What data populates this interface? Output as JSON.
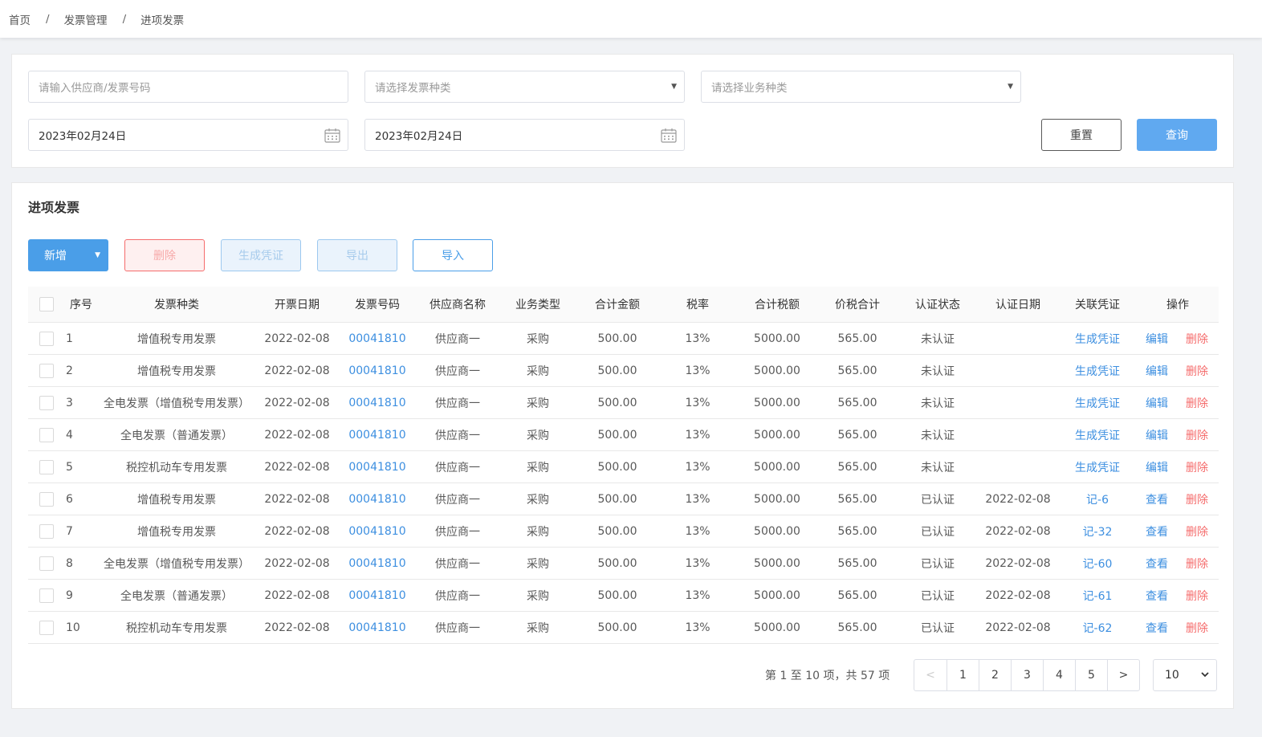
{
  "breadcrumb": {
    "items": [
      "首页",
      "发票管理",
      "进项发票"
    ],
    "separator": "/"
  },
  "filters": {
    "search_placeholder": "请输入供应商/发票号码",
    "invoice_type_placeholder": "请选择发票种类",
    "business_type_placeholder": "请选择业务种类",
    "date_start": "2023年02月24日",
    "date_end": "2023年02月24日",
    "reset_label": "重置",
    "query_label": "查询"
  },
  "section_title": "进项发票",
  "toolbar": {
    "add_label": "新增",
    "delete_label": "删除",
    "voucher_label": "生成凭证",
    "export_label": "导出",
    "import_label": "导入"
  },
  "table": {
    "columns": [
      "序号",
      "发票种类",
      "开票日期",
      "发票号码",
      "供应商名称",
      "业务类型",
      "合计金额",
      "税率",
      "合计税额",
      "价税合计",
      "认证状态",
      "认证日期",
      "关联凭证",
      "操作"
    ],
    "rows": [
      {
        "no": "1",
        "type": "增值税专用发票",
        "date": "2022-02-08",
        "number": "00041810",
        "supplier": "供应商一",
        "biz": "采购",
        "amount": "500.00",
        "rate": "13%",
        "tax": "5000.00",
        "total": "565.00",
        "status": "未认证",
        "cert_date": "",
        "voucher": "生成凭证",
        "action": "编辑",
        "del": "删除"
      },
      {
        "no": "2",
        "type": "增值税专用发票",
        "date": "2022-02-08",
        "number": "00041810",
        "supplier": "供应商一",
        "biz": "采购",
        "amount": "500.00",
        "rate": "13%",
        "tax": "5000.00",
        "total": "565.00",
        "status": "未认证",
        "cert_date": "",
        "voucher": "生成凭证",
        "action": "编辑",
        "del": "删除"
      },
      {
        "no": "3",
        "type": "全电发票（增值税专用发票）",
        "date": "2022-02-08",
        "number": "00041810",
        "supplier": "供应商一",
        "biz": "采购",
        "amount": "500.00",
        "rate": "13%",
        "tax": "5000.00",
        "total": "565.00",
        "status": "未认证",
        "cert_date": "",
        "voucher": "生成凭证",
        "action": "编辑",
        "del": "删除"
      },
      {
        "no": "4",
        "type": "全电发票（普通发票）",
        "date": "2022-02-08",
        "number": "00041810",
        "supplier": "供应商一",
        "biz": "采购",
        "amount": "500.00",
        "rate": "13%",
        "tax": "5000.00",
        "total": "565.00",
        "status": "未认证",
        "cert_date": "",
        "voucher": "生成凭证",
        "action": "编辑",
        "del": "删除"
      },
      {
        "no": "5",
        "type": "税控机动车专用发票",
        "date": "2022-02-08",
        "number": "00041810",
        "supplier": "供应商一",
        "biz": "采购",
        "amount": "500.00",
        "rate": "13%",
        "tax": "5000.00",
        "total": "565.00",
        "status": "未认证",
        "cert_date": "",
        "voucher": "生成凭证",
        "action": "编辑",
        "del": "删除"
      },
      {
        "no": "6",
        "type": "增值税专用发票",
        "date": "2022-02-08",
        "number": "00041810",
        "supplier": "供应商一",
        "biz": "采购",
        "amount": "500.00",
        "rate": "13%",
        "tax": "5000.00",
        "total": "565.00",
        "status": "已认证",
        "cert_date": "2022-02-08",
        "voucher": "记-6",
        "action": "查看",
        "del": "删除"
      },
      {
        "no": "7",
        "type": "增值税专用发票",
        "date": "2022-02-08",
        "number": "00041810",
        "supplier": "供应商一",
        "biz": "采购",
        "amount": "500.00",
        "rate": "13%",
        "tax": "5000.00",
        "total": "565.00",
        "status": "已认证",
        "cert_date": "2022-02-08",
        "voucher": "记-32",
        "action": "查看",
        "del": "删除"
      },
      {
        "no": "8",
        "type": "全电发票（增值税专用发票）",
        "date": "2022-02-08",
        "number": "00041810",
        "supplier": "供应商一",
        "biz": "采购",
        "amount": "500.00",
        "rate": "13%",
        "tax": "5000.00",
        "total": "565.00",
        "status": "已认证",
        "cert_date": "2022-02-08",
        "voucher": "记-60",
        "action": "查看",
        "del": "删除"
      },
      {
        "no": "9",
        "type": "全电发票（普通发票）",
        "date": "2022-02-08",
        "number": "00041810",
        "supplier": "供应商一",
        "biz": "采购",
        "amount": "500.00",
        "rate": "13%",
        "tax": "5000.00",
        "total": "565.00",
        "status": "已认证",
        "cert_date": "2022-02-08",
        "voucher": "记-61",
        "action": "查看",
        "del": "删除"
      },
      {
        "no": "10",
        "type": "税控机动车专用发票",
        "date": "2022-02-08",
        "number": "00041810",
        "supplier": "供应商一",
        "biz": "采购",
        "amount": "500.00",
        "rate": "13%",
        "tax": "5000.00",
        "total": "565.00",
        "status": "已认证",
        "cert_date": "2022-02-08",
        "voucher": "记-62",
        "action": "查看",
        "del": "删除"
      }
    ]
  },
  "pagination": {
    "info": "第 1 至 10 项，共 57 项",
    "prev": "<",
    "pages": [
      "1",
      "2",
      "3",
      "4",
      "5"
    ],
    "next": ">",
    "page_size": "10"
  },
  "colors": {
    "primary": "#4a9ee8",
    "link": "#3d8fe0",
    "danger": "#f56c6c"
  }
}
